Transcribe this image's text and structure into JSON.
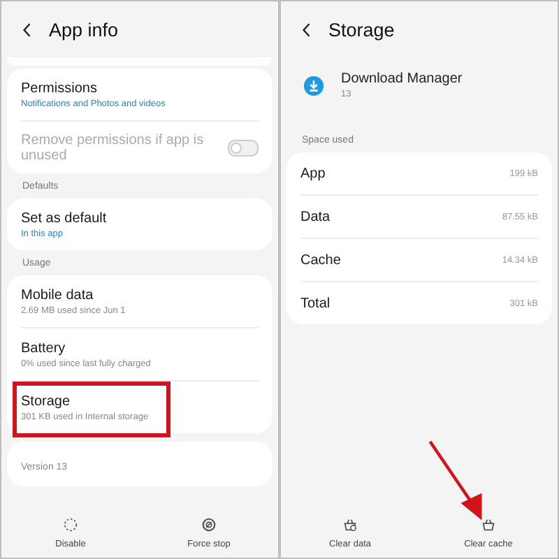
{
  "app_info": {
    "title": "App info",
    "sections": [
      {
        "items": [
          {
            "title": "Permissions",
            "subtitle": "Notifications and Photos and videos",
            "kind": "link",
            "disabled": false,
            "highlighted": false
          },
          {
            "title": "Remove permissions if app is unused",
            "kind": "toggle",
            "on": false,
            "disabled": true,
            "highlighted": false
          }
        ]
      },
      {
        "label": "Defaults",
        "items": [
          {
            "title": "Set as default",
            "subtitle": "In this app",
            "kind": "link",
            "disabled": false,
            "highlighted": false
          }
        ]
      },
      {
        "label": "Usage",
        "items": [
          {
            "title": "Mobile data",
            "subtitle": "2.69 MB used since Jun 1",
            "kind": "info",
            "disabled": false,
            "highlighted": false
          },
          {
            "title": "Battery",
            "subtitle": "0% used since last fully charged",
            "kind": "info",
            "disabled": false,
            "highlighted": false
          },
          {
            "title": "Storage",
            "subtitle": "301 KB used in Internal storage",
            "kind": "info",
            "disabled": false,
            "highlighted": true
          }
        ]
      }
    ],
    "version": "Version 13",
    "actions": [
      {
        "label": "Disable",
        "kind": "disable",
        "pointed": false
      },
      {
        "label": "Force stop",
        "kind": "stop",
        "pointed": false
      }
    ]
  },
  "storage": {
    "title": "Storage",
    "app_name": "Download Manager",
    "app_version": "13",
    "section_label": "Space used",
    "rows": [
      {
        "label": "App",
        "value": "199 kB"
      },
      {
        "label": "Data",
        "value": "87.55 kB"
      },
      {
        "label": "Cache",
        "value": "14.34 kB"
      },
      {
        "label": "Total",
        "value": "301 kB"
      }
    ],
    "actions": [
      {
        "label": "Clear data",
        "kind": "clear-data",
        "pointed": false
      },
      {
        "label": "Clear cache",
        "kind": "clear-cache",
        "pointed": true
      }
    ]
  }
}
